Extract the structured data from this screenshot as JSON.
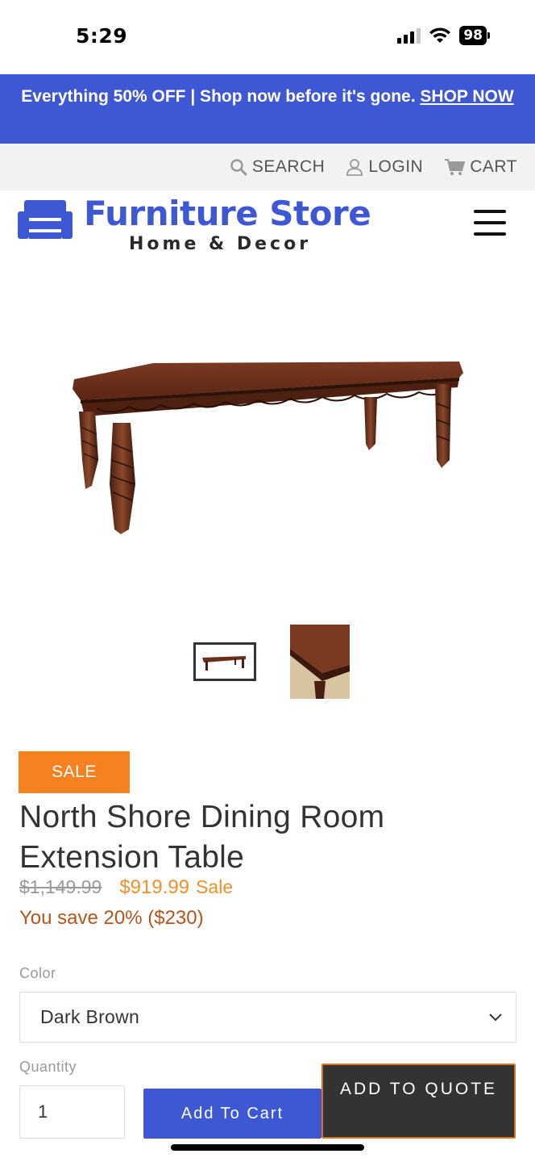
{
  "status_bar": {
    "time": "5:29",
    "battery": "98",
    "icons": [
      "signal-icon",
      "wifi-icon",
      "battery-icon"
    ]
  },
  "announcement": {
    "text": "Everything 50% OFF | Shop now before it's gone.",
    "link": "SHOP NOW"
  },
  "utility_nav": {
    "search": "SEARCH",
    "login": "LOGIN",
    "cart": "CART"
  },
  "header": {
    "logo_title": "Furniture Store",
    "logo_subtitle": "Home & Decor"
  },
  "product": {
    "badge": "SALE",
    "title": "North Shore Dining Room Extension Table",
    "price_original": "$1,149.99",
    "price_sale": "$919.99",
    "price_sale_label": "Sale",
    "savings": "You save 20% ($230)",
    "color_label": "Color",
    "color_value": "Dark Brown",
    "quantity_label": "Quantity",
    "quantity_value": "1",
    "add_to_cart": "Add To Cart",
    "add_to_quote": "ADD TO QUOTE"
  },
  "colors": {
    "brand_blue": "#3e57d2",
    "sale_orange": "#f5821f",
    "price_orange": "#f0902a",
    "savings_brown": "#b5541b",
    "quote_button": "#333333"
  }
}
